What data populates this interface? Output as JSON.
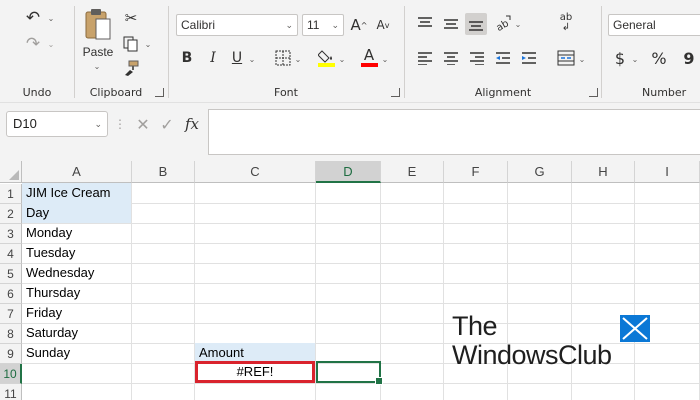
{
  "ribbon": {
    "groups": {
      "undo": "Undo",
      "clipboard": "Clipboard",
      "font": "Font",
      "alignment": "Alignment",
      "number": "Number"
    },
    "paste_label": "Paste",
    "font_name": "Calibri",
    "font_size": "11",
    "number_format": "General",
    "font_grow": "A",
    "font_shrink": "A",
    "bold": "B",
    "italic": "I",
    "underline": "U",
    "font_color_glyph": "A",
    "currency": "$",
    "percent": "%",
    "comma": "9",
    "wrap_glyph": "ab"
  },
  "formula_bar": {
    "name_box": "D10",
    "fx": "fx",
    "formula": ""
  },
  "grid": {
    "columns": [
      "A",
      "B",
      "C",
      "D",
      "E",
      "F",
      "G",
      "H",
      "I"
    ],
    "selected_column": "D",
    "rows": [
      "1",
      "2",
      "3",
      "4",
      "5",
      "6",
      "7",
      "8",
      "9",
      "10",
      "11"
    ],
    "selected_row": "10",
    "cells": {
      "A1": "JIM Ice Cream",
      "A2": "Day",
      "A3": "Monday",
      "A4": "Tuesday",
      "A5": "Wednesday",
      "A6": "Thursday",
      "A7": "Friday",
      "A8": "Saturday",
      "A9": "Sunday",
      "C9": "Amount",
      "C10": "#REF!"
    }
  },
  "colors": {
    "accent": "#217346",
    "highlight_fill": "#ddebf7",
    "error_box": "#d9232d"
  },
  "watermark": {
    "line1": "The",
    "line2": "WindowsClub"
  }
}
